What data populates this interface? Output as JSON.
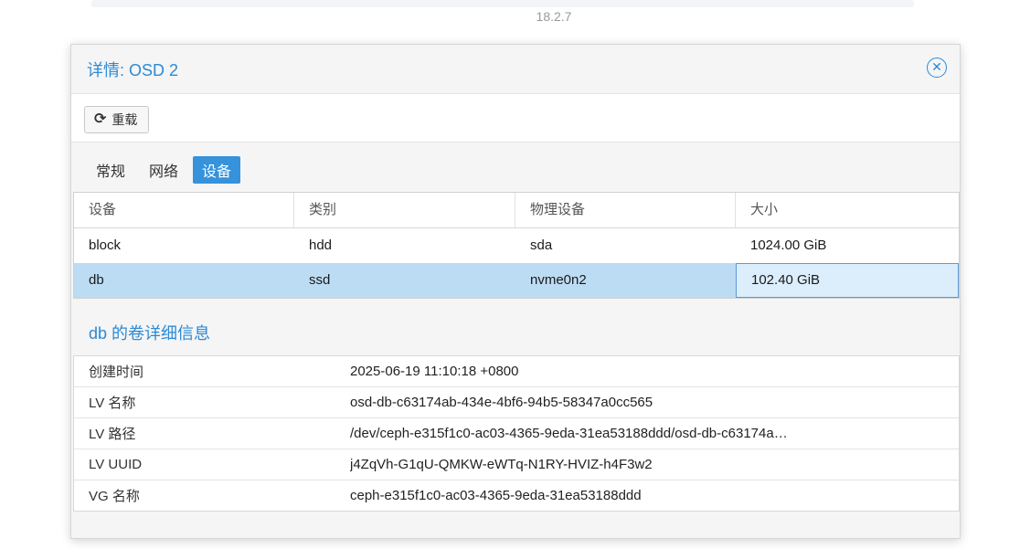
{
  "background": {
    "version_text": "18.2.7"
  },
  "dialog": {
    "title": "详情: OSD 2",
    "toolbar": {
      "reload_label": "重载"
    },
    "tabs": [
      {
        "label": "常规",
        "active": false
      },
      {
        "label": "网络",
        "active": false
      },
      {
        "label": "设备",
        "active": true
      }
    ],
    "devices_table": {
      "columns": [
        "设备",
        "类别",
        "物理设备",
        "大小"
      ],
      "rows": [
        [
          "block",
          "hdd",
          "sda",
          "1024.00 GiB"
        ],
        [
          "db",
          "ssd",
          "nvme0n2",
          "102.40 GiB"
        ]
      ],
      "selected_row": 1
    },
    "detail": {
      "title": "db 的卷详细信息",
      "rows": [
        {
          "key": "创建时间",
          "value": "2025-06-19 11:10:18 +0800"
        },
        {
          "key": "LV 名称",
          "value": "osd-db-c63174ab-434e-4bf6-94b5-58347a0cc565"
        },
        {
          "key": "LV 路径",
          "value": "/dev/ceph-e315f1c0-ac03-4365-9eda-31ea53188ddd/osd-db-c63174a…"
        },
        {
          "key": "LV UUID",
          "value": "j4ZqVh-G1qU-QMKW-eWTq-N1RY-HVIZ-h4F3w2"
        },
        {
          "key": "VG 名称",
          "value": "ceph-e315f1c0-ac03-4365-9eda-31ea53188ddd"
        }
      ]
    }
  },
  "colors": {
    "accent": "#2b8ad6",
    "selected_row": "#bcdcf3",
    "active_tab": "#3592db"
  },
  "icons": {
    "close": "close-circle-icon",
    "reload": "reload-icon"
  }
}
